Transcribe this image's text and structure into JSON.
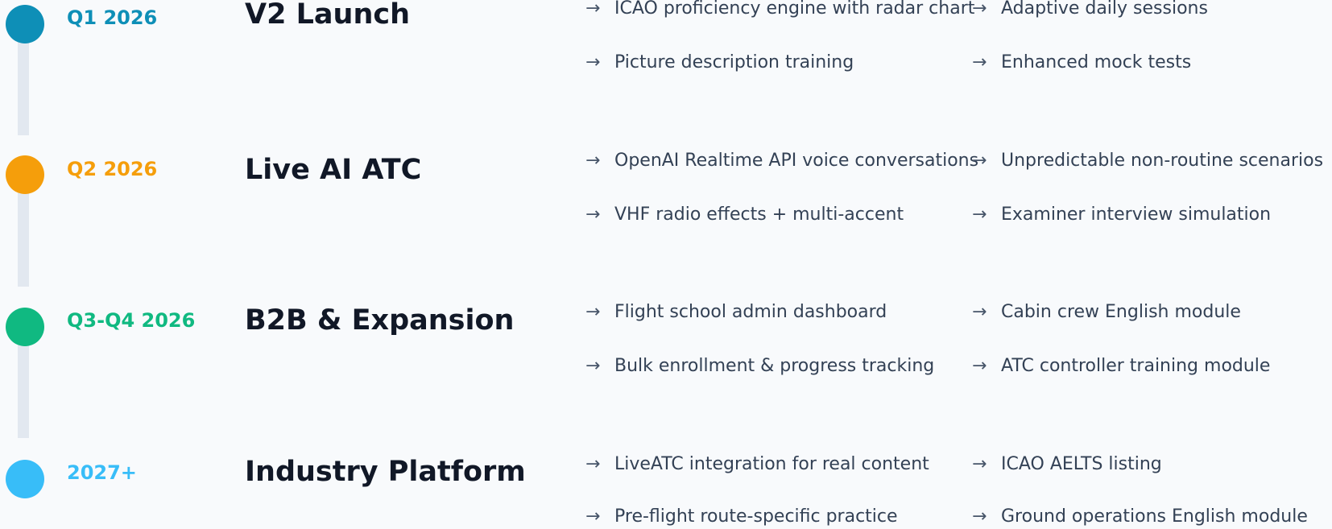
{
  "phases": [
    {
      "quarter": "Q1 2026",
      "title": "V2 Launch",
      "color": "#0e8fb7",
      "features": [
        "ICAO proficiency engine with radar chart",
        "Adaptive daily sessions",
        "Picture description training",
        "Enhanced mock tests"
      ]
    },
    {
      "quarter": "Q2 2026",
      "title": "Live AI ATC",
      "color": "#f59e0b",
      "features": [
        "OpenAI Realtime API voice conversations",
        "Unpredictable non-routine scenarios",
        "VHF radio effects + multi-accent",
        "Examiner interview simulation"
      ]
    },
    {
      "quarter": "Q3-Q4 2026",
      "title": "B2B & Expansion",
      "color": "#10b981",
      "features": [
        "Flight school admin dashboard",
        "Cabin crew English module",
        "Bulk enrollment & progress tracking",
        "ATC controller training module"
      ]
    },
    {
      "quarter": "2027+",
      "title": "Industry Platform",
      "color": "#38bdf8",
      "features": [
        "LiveATC integration for real content",
        "ICAO AELTS listing",
        "Pre-flight route-specific practice",
        "Ground operations English module"
      ]
    }
  ],
  "arrow_glyph": "→"
}
